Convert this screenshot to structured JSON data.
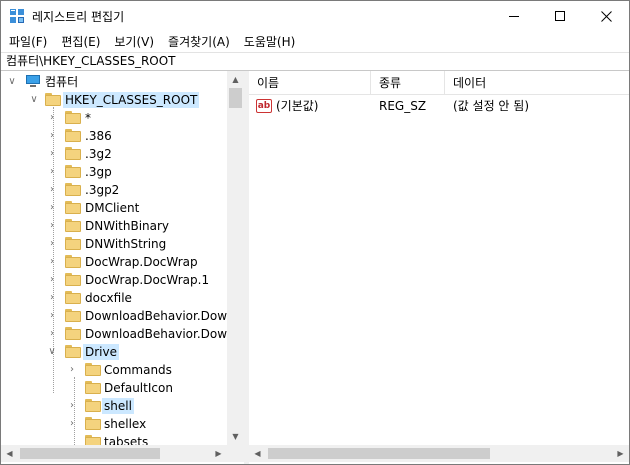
{
  "window": {
    "title": "레지스트리 편집기",
    "controls": {
      "minimize": "—",
      "maximize": "☐",
      "close": "✕"
    }
  },
  "menu": [
    {
      "label": "파일(F)"
    },
    {
      "label": "편집(E)"
    },
    {
      "label": "보기(V)"
    },
    {
      "label": "즐겨찾기(A)"
    },
    {
      "label": "도움말(H)"
    }
  ],
  "address": "컴퓨터\\HKEY_CLASSES_ROOT",
  "tree": {
    "root": "컴퓨터",
    "hive": "HKEY_CLASSES_ROOT",
    "items": [
      {
        "label": "*"
      },
      {
        "label": ".386"
      },
      {
        "label": ".3g2"
      },
      {
        "label": ".3gp"
      },
      {
        "label": ".3gp2"
      },
      {
        "label": "DMClient"
      },
      {
        "label": "DNWithBinary"
      },
      {
        "label": "DNWithString"
      },
      {
        "label": "DocWrap.DocWrap"
      },
      {
        "label": "DocWrap.DocWrap.1"
      },
      {
        "label": "docxfile"
      },
      {
        "label": "DownloadBehavior.Downl"
      },
      {
        "label": "DownloadBehavior.Downl"
      },
      {
        "label": "Drive"
      }
    ],
    "drive_children": [
      {
        "label": "Commands"
      },
      {
        "label": "DefaultIcon"
      },
      {
        "label": "shell"
      },
      {
        "label": "shellex"
      },
      {
        "label": "tabsets"
      }
    ]
  },
  "list": {
    "columns": [
      "이름",
      "종류",
      "데이터"
    ],
    "rows": [
      {
        "name": "(기본값)",
        "type": "REG_SZ",
        "data": "(값 설정 안 됨)",
        "icon": "ab"
      }
    ]
  },
  "icons": {
    "expanded": "∨",
    "collapsed": "›",
    "scroll_up": "▲",
    "scroll_down": "▼",
    "scroll_left": "◀",
    "scroll_right": "▶"
  },
  "colors": {
    "selection": "#cce8ff",
    "folder": "#f4d37e",
    "chrome": "#f0f0f0"
  }
}
